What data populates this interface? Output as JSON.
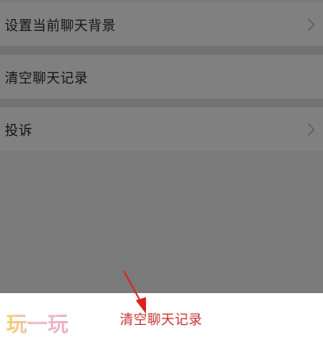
{
  "settings": {
    "items": [
      {
        "label": "设置当前聊天背景",
        "has_chevron": true
      },
      {
        "label": "清空聊天记录",
        "has_chevron": false
      },
      {
        "label": "投诉",
        "has_chevron": true
      }
    ]
  },
  "action_sheet": {
    "action_label": "清空聊天记录",
    "action_color": "#c73430"
  },
  "watermark": {
    "text": "玩一玩"
  },
  "colors": {
    "overlay_row": "#808080",
    "overlay_gap": "#727272",
    "annotation_arrow": "#e02020"
  },
  "icons": [
    "chevron-right-icon",
    "red-arrow-annotation"
  ]
}
